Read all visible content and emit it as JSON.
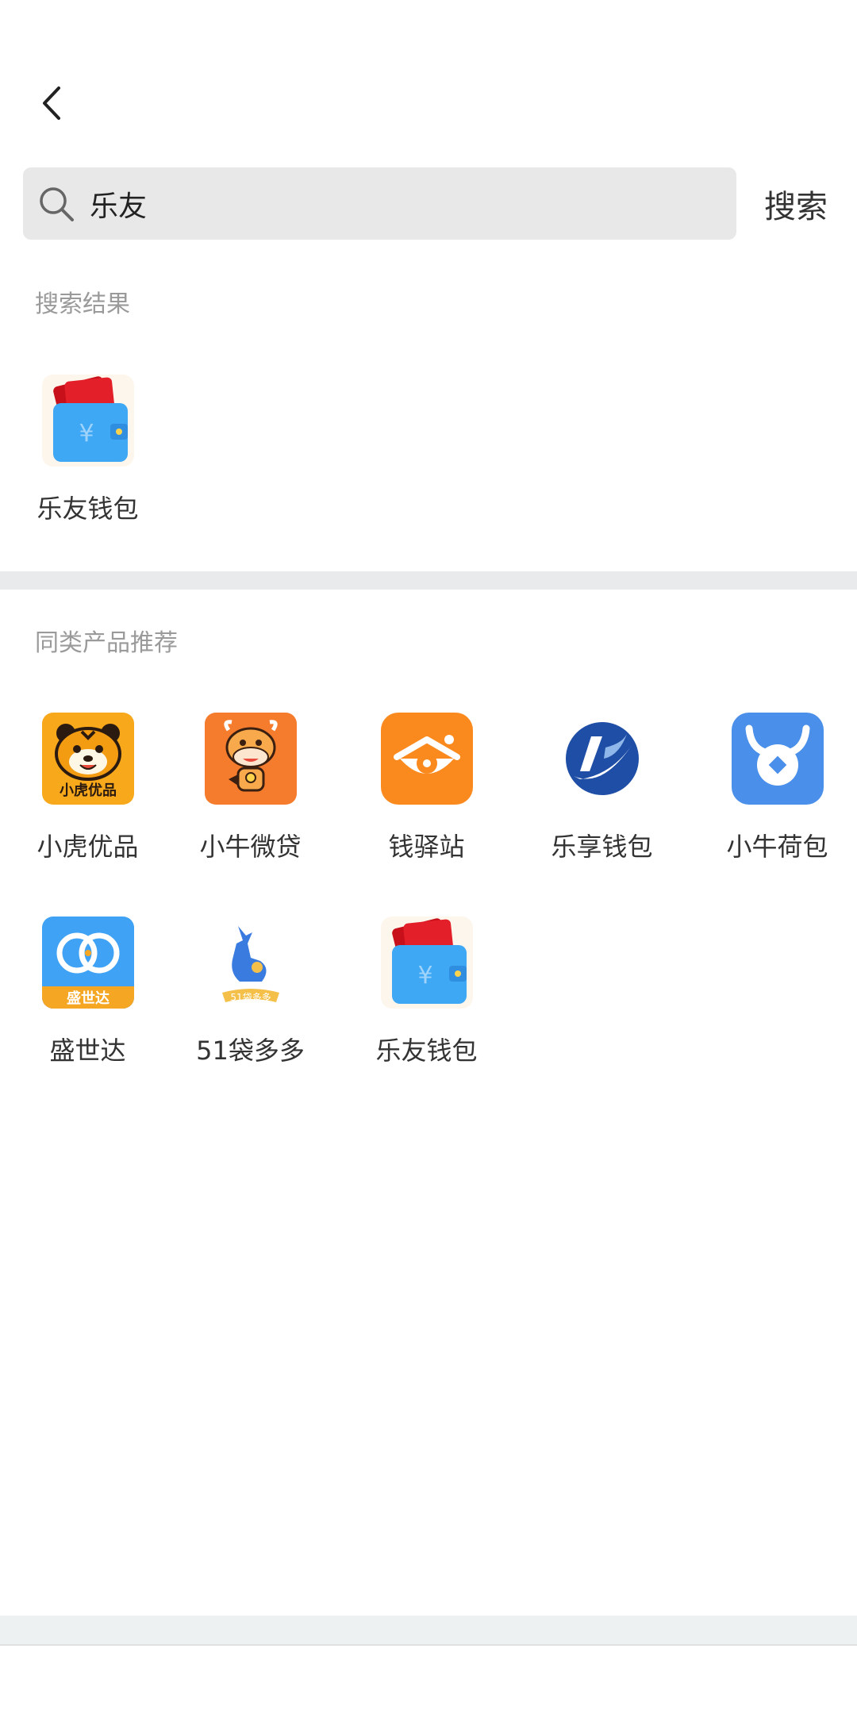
{
  "search": {
    "value": "乐友",
    "button_label": "搜索"
  },
  "results": {
    "title": "搜索结果",
    "items": [
      {
        "name": "乐友钱包",
        "icon": "wallet-icon"
      }
    ]
  },
  "recommend": {
    "title": "同类产品推荐",
    "items": [
      {
        "name": "小虎优品",
        "icon": "tiger-icon",
        "badge": "小虎优品"
      },
      {
        "name": "小牛微贷",
        "icon": "cow-icon"
      },
      {
        "name": "钱驿站",
        "icon": "eye-house-icon"
      },
      {
        "name": "乐享钱包",
        "icon": "swoosh-logo-icon"
      },
      {
        "name": "小牛荷包",
        "icon": "horned-coin-icon"
      },
      {
        "name": "盛世达",
        "icon": "rings-icon",
        "badge": "盛世达"
      },
      {
        "name": "51袋多多",
        "icon": "kangaroo-icon",
        "badge": "51袋多多"
      },
      {
        "name": "乐友钱包",
        "icon": "wallet-icon"
      }
    ]
  },
  "colors": {
    "search_bg": "#e8e8e8",
    "divider": "#e8eaeb",
    "label": "#9a9a9a",
    "text": "#333333"
  }
}
